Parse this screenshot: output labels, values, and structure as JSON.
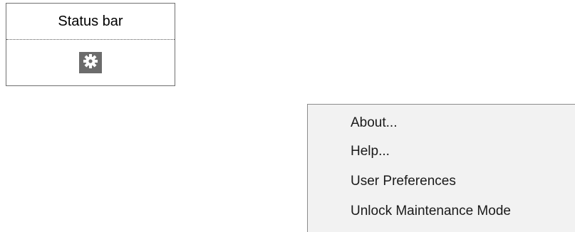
{
  "status_bar": {
    "title": "Status bar",
    "icon": "gear-icon"
  },
  "context_menu": {
    "items": [
      {
        "label": "About..."
      },
      {
        "label": "Help..."
      },
      {
        "label": "User Preferences"
      },
      {
        "label": "Unlock Maintenance Mode"
      }
    ]
  },
  "colors": {
    "gear_tile_background": "#6c6c6c",
    "menu_background": "#f2f2f2",
    "menu_border": "#8c8c8c",
    "box_border": "#707070"
  }
}
